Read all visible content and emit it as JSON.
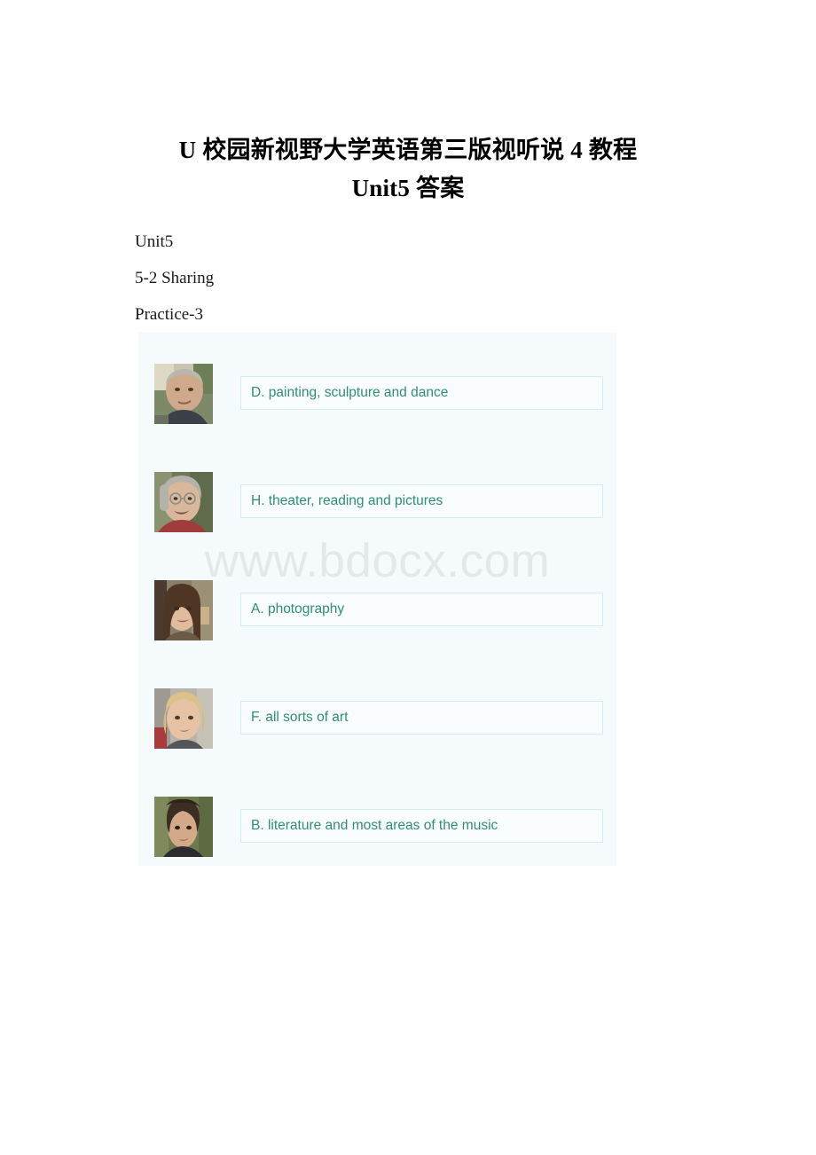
{
  "document": {
    "title_line1": "U 校园新视野大学英语第三版视听说 4 教程",
    "title_line2": "Unit5 答案",
    "lines": [
      "Unit5",
      "5-2 Sharing",
      "Practice-3"
    ]
  },
  "screenshot": {
    "watermark": "www.bdocx.com",
    "background_color": "#f5fafd",
    "option_text_color": "#2f8f72",
    "option_border_color": "#d4ecf7",
    "options": [
      {
        "letter": "D.",
        "text": "painting, sculpture and dance",
        "full": "D. painting, sculpture and dance",
        "speaker": "man-short-gray-hair"
      },
      {
        "letter": "H.",
        "text": "theater, reading and pictures",
        "full": "H. theater, reading and pictures",
        "speaker": "older-woman-with-glasses"
      },
      {
        "letter": "A.",
        "text": "photography",
        "full": "A. photography",
        "speaker": "young-woman-long-brown-hair"
      },
      {
        "letter": "F.",
        "text": "all sorts of art",
        "full": "F.  all sorts of art",
        "speaker": "blonde-woman"
      },
      {
        "letter": "B.",
        "text": "literature and most areas of the music",
        "full": "B. literature and most areas of the music",
        "speaker": "young-man-curly-dark-hair"
      }
    ]
  }
}
